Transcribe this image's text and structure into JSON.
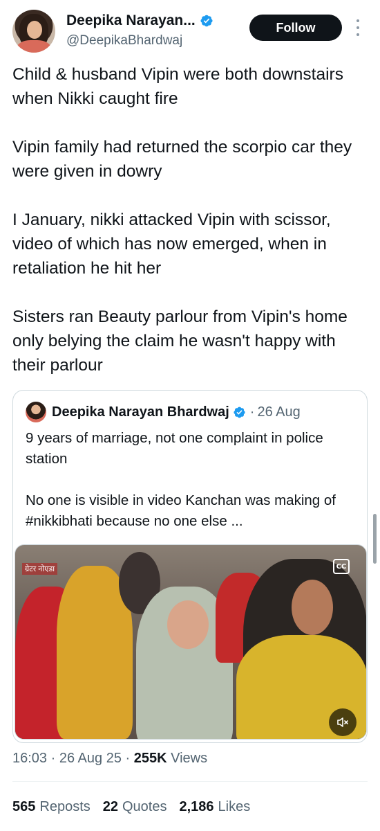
{
  "author": {
    "display_name": "Deepika Narayan...",
    "handle": "@DeepikaBhardwaj",
    "verified": true
  },
  "follow_label": "Follow",
  "tweet_paragraphs": [
    "Child & husband Vipin were both downstairs when Nikki caught fire",
    "Vipin family had returned the scorpio car they were given in dowry",
    "I January, nikki attacked Vipin with scissor, video of which has now emerged, when in retaliation he hit her",
    "Sisters ran Beauty parlour from Vipin's home only belying the claim he wasn't happy with their parlour"
  ],
  "quote": {
    "display_name": "Deepika Narayan Bhardwaj",
    "separator": "·",
    "date": "26 Aug",
    "paragraphs": [
      "9 years of marriage, not one complaint in police station",
      "No one is visible in video Kanchan was making of #nikkibhati because no one else ..."
    ],
    "media": {
      "channel_tag": "ग्रेटर नोएडा",
      "cc_label": "CC",
      "mute_icon": "speaker-muted-icon"
    }
  },
  "meta": {
    "time": "16:03",
    "sep": "·",
    "date": "26 Aug 25",
    "views_count": "255K",
    "views_label": "Views"
  },
  "stats": {
    "reposts_count": "565",
    "reposts_label": "Reposts",
    "quotes_count": "22",
    "quotes_label": "Quotes",
    "likes_count": "2,186",
    "likes_label": "Likes"
  },
  "colors": {
    "text_primary": "#0f1419",
    "text_secondary": "#536471",
    "verified_blue": "#1d9bf0",
    "follow_bg": "#0f1419",
    "border": "#cfd9de"
  }
}
